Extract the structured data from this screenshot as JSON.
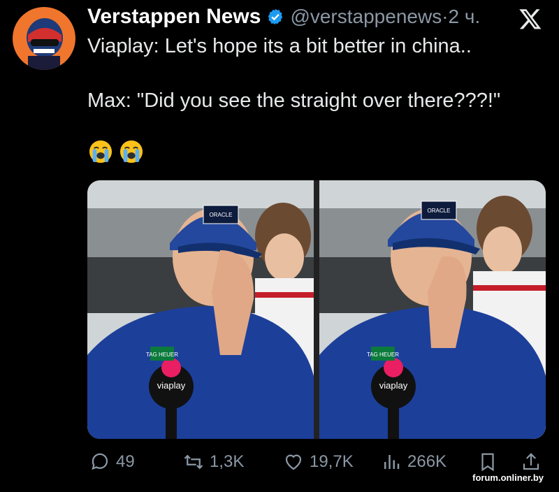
{
  "tweet": {
    "author_name": "Verstappen News",
    "author_handle": "@verstappenews",
    "separator": "·",
    "time": "2 ч.",
    "text_line1": "Viaplay: Let's hope its a bit better in china..",
    "text_line2": "Max: \"Did you see the straight over there???!\"",
    "emojis": [
      "loudly-crying-face",
      "loudly-crying-face"
    ]
  },
  "photos": [
    {
      "cap_text": "ORACLE",
      "mic_label": "viaplay",
      "tag": "TAG HEUER"
    },
    {
      "cap_text": "ORACLE",
      "mic_label": "viaplay",
      "tag": "TAG HEUER"
    }
  ],
  "stats": {
    "replies": "49",
    "retweets": "1,3K",
    "likes": "19,7K",
    "views": "266K"
  },
  "watermark": "forum.onliner.by",
  "colors": {
    "background": "#000000",
    "text": "#e7e9ea",
    "muted": "#8b98a5",
    "verified": "#1d9bf0",
    "avatar_bg": "#f0762d"
  }
}
